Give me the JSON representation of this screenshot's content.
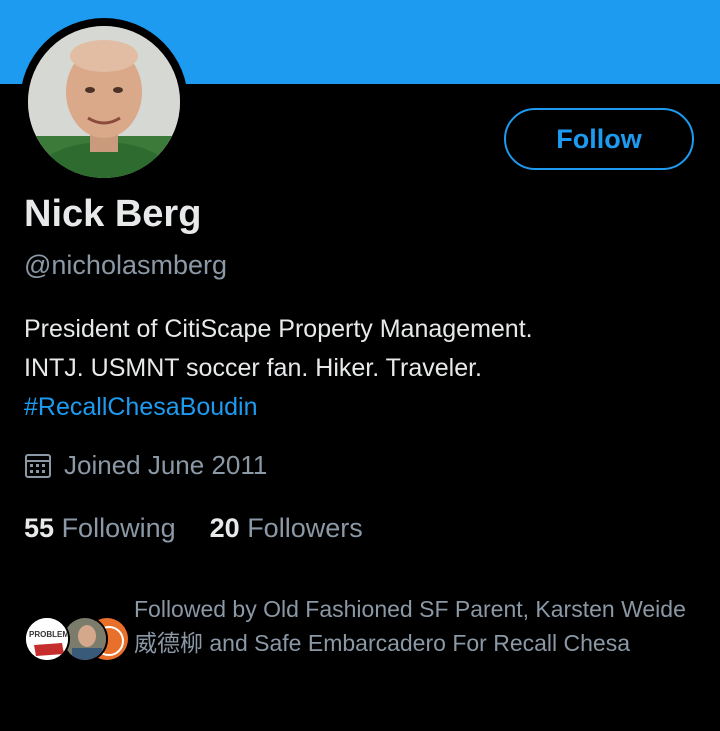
{
  "colors": {
    "banner": "#1d9bf0",
    "accent": "#1d9bf0",
    "background": "#000000",
    "primary_text": "#e7e9ea",
    "secondary_text": "#8b98a5"
  },
  "profile": {
    "name": "Nick Berg",
    "handle": "@nicholasmberg",
    "follow_label": "Follow",
    "bio_lines": [
      "President of CitiScape Property Management.",
      "INTJ. USMNT soccer fan. Hiker. Traveler."
    ],
    "bio_hashtag": "#RecallChesaBoudin",
    "joined": "Joined June 2011",
    "joined_icon": "calendar-icon",
    "following_count": "55",
    "following_label": "Following",
    "followers_count": "20",
    "followers_label": "Followers"
  },
  "followed_by": {
    "text": "Followed by Old Fashioned SF Parent, Karsten Weide 威德柳 and Safe Embarcadero For Recall Chesa",
    "avatar_logo_text": "PROBLEM"
  }
}
